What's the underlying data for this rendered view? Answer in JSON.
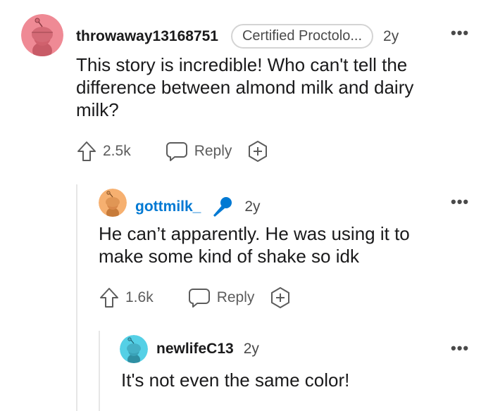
{
  "comments": [
    {
      "username": "throwaway13168751",
      "flair": "Certified Proctolo...",
      "time": "2y",
      "body": "This story is incredible! Who can't tell the difference between almond milk and dairy milk?",
      "upvotes": "2.5k",
      "reply_label": "Reply",
      "avatar_color": "#ef7f8a"
    },
    {
      "username": "gottmilk_",
      "time": "2y",
      "body": "He can’t apparently. He was using it to make some kind of shake so idk",
      "upvotes": "1.6k",
      "reply_label": "Reply",
      "avatar_color": "#f2a85e"
    },
    {
      "username": "newlifeC13",
      "time": "2y",
      "body": "It's not even the same color!",
      "avatar_color": "#4ec8de"
    }
  ],
  "more_label": "•••",
  "icons": {
    "upvote": "arrow-up-icon",
    "reply": "speech-bubble-icon",
    "award": "plus-hexagon-icon",
    "mic": "microphone-icon"
  },
  "colors": {
    "username_link": "#0079d3",
    "mic": "#0079d3",
    "thread_line": "#e6e6e6"
  }
}
